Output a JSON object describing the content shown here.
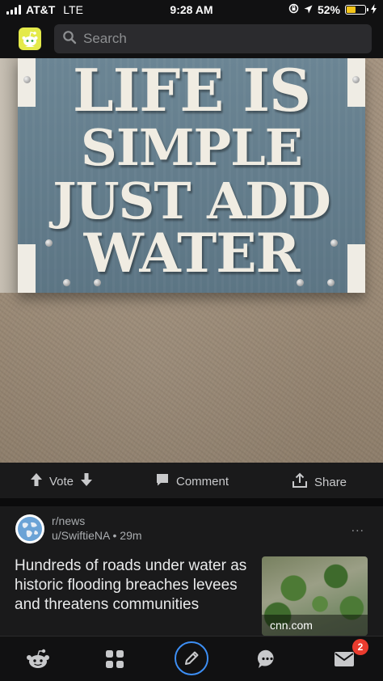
{
  "status_bar": {
    "carrier": "AT&T",
    "network": "LTE",
    "time": "9:28 AM",
    "battery_percent": "52%",
    "battery_level": 0.52,
    "battery_color": "#f5c518"
  },
  "header": {
    "logo_icon": "snoo-icon",
    "search_placeholder": "Search"
  },
  "post_image": {
    "sign_lines": [
      "LIFE IS",
      "SIMPLE",
      "JUST ADD",
      "WATER"
    ]
  },
  "actions": {
    "vote_label": "Vote",
    "comment_label": "Comment",
    "share_label": "Share"
  },
  "next_post": {
    "subreddit": "r/news",
    "user": "u/SwiftieNA",
    "age": "29m",
    "more": "...",
    "title": "Hundreds of roads under water as historic flooding breaches levees and threatens communities",
    "domain": "cnn.com"
  },
  "bottom_nav": {
    "items": [
      "home-icon",
      "popular-icon",
      "create-post-icon",
      "chat-icon",
      "inbox-icon"
    ],
    "inbox_badge": "2",
    "create_ring_color": "#3d8ff5"
  }
}
